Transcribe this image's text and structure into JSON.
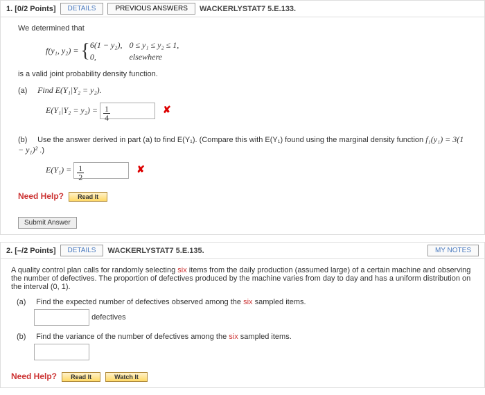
{
  "q1": {
    "points": "1. [0/2 Points]",
    "details_btn": "DETAILS",
    "prev_btn": "PREVIOUS ANSWERS",
    "assignment": "WACKERLYSTAT7 5.E.133.",
    "intro": "We determined that",
    "pdf_lhs": "f(y₁, y₂) = ",
    "piece1_expr": "6(1 − y₂),",
    "piece1_cond": "0 ≤ y₁ ≤ y₂ ≤ 1,",
    "piece2_expr": "0,",
    "piece2_cond": "elsewhere",
    "valid_line": "is a valid joint probability density function.",
    "part_a_label": "(a)",
    "part_a_prompt": "Find E(Y₁|Y₂ = y₂).",
    "part_a_lhs": "E(Y₁|Y₂ = y₂) = ",
    "part_a_ans_num": "1",
    "part_a_ans_den": "4",
    "part_b_label": "(b)",
    "part_b_prompt_1": "Use the answer derived in part (a) to find E(Y₁). (Compare this with E(Y₁) found using the marginal density function ",
    "part_b_prompt_marg": "f₁(y₁) = 3(1 − y₁)²",
    "part_b_prompt_2": ".)",
    "part_b_lhs": "E(Y₁) = ",
    "part_b_ans_num": "1",
    "part_b_ans_den": "2",
    "need_help": "Need Help?",
    "read_it": "Read It",
    "submit": "Submit Answer"
  },
  "q2": {
    "points": "2. [–/2 Points]",
    "details_btn": "DETAILS",
    "assignment": "WACKERLYSTAT7 5.E.135.",
    "mynotes": "MY NOTES",
    "intro_1": "A quality control plan calls for randomly selecting ",
    "intro_six": "six",
    "intro_2": " items from the daily production (assumed large) of a certain machine and observing the number of defectives. The proportion of defectives produced by the machine varies from day to day and has a uniform distribution on the interval (0, 1).",
    "part_a_label": "(a)",
    "part_a_prompt_1": "Find the expected number of defectives observed among the ",
    "part_a_prompt_2": " sampled items.",
    "part_a_unit": "defectives",
    "part_b_label": "(b)",
    "part_b_prompt_1": "Find the variance of the number of defectives among the ",
    "part_b_prompt_2": " sampled items.",
    "need_help": "Need Help?",
    "read_it": "Read It",
    "watch_it": "Watch It"
  }
}
